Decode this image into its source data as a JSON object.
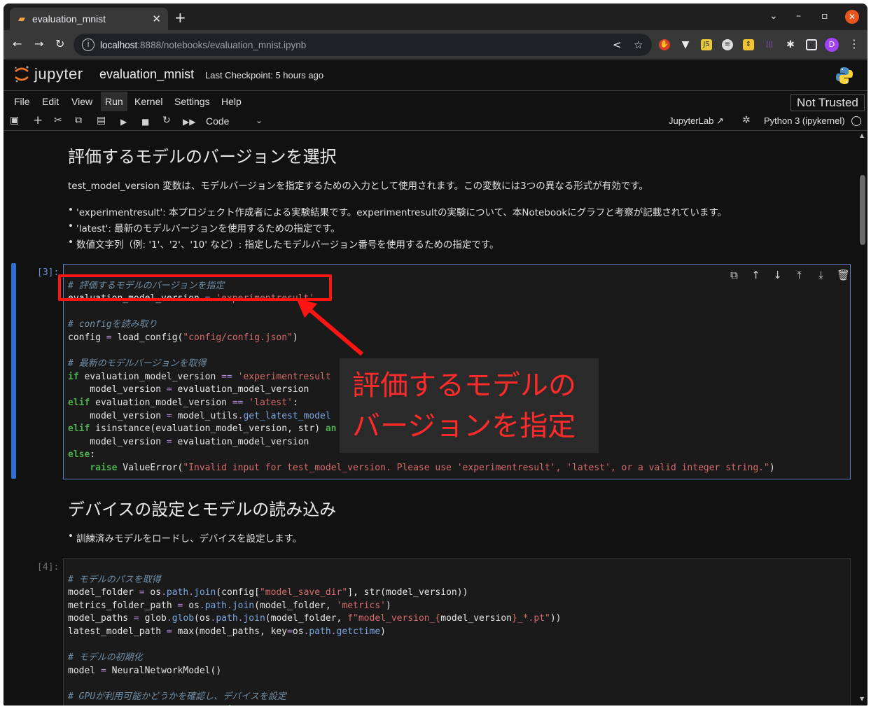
{
  "browser": {
    "tab_title": "evaluation_mnist",
    "url_host": "localhost",
    "url_path": ":8888/notebooks/evaluation_mnist.ipynb",
    "profile_initial": "D"
  },
  "jupyter": {
    "logo_text": "jupyter",
    "notebook_name": "evaluation_mnist",
    "checkpoint": "Last Checkpoint: 5 hours ago",
    "menu": [
      "File",
      "Edit",
      "View",
      "Run",
      "Kernel",
      "Settings",
      "Help"
    ],
    "trust_status": "Not Trusted",
    "cell_type": "Code",
    "jupyterlab_link": "JupyterLab",
    "kernel": "Python 3 (ipykernel)"
  },
  "markdown1": {
    "heading": "評価するモデルのバージョンを選択",
    "intro": "test_model_version 変数は、モデルバージョンを指定するための入力として使用されます。この変数には3つの異なる形式が有効です。",
    "bullets": [
      "'experimentresult': 本プロジェクト作成者による実験結果です。experimentresultの実験について、本Notebookにグラフと考察が記載されています。",
      "'latest': 最新のモデルバージョンを使用するための指定です。",
      "数値文字列（例: '1'、'2'、'10' など）: 指定したモデルバージョン番号を使用するための指定です。"
    ]
  },
  "cell3": {
    "prompt": "[3]:",
    "lines": [
      "# 評価するモデルのバージョンを指定",
      "evaluation_model_version = 'experimentresult'",
      "",
      "# configを読み取り",
      "config = load_config(\"config/config.json\")",
      "",
      "# 最新のモデルバージョンを取得",
      "if evaluation_model_version == 'experimentresult",
      "    model_version = evaluation_model_version",
      "elif evaluation_model_version == 'latest':",
      "    model_version = model_utils.get_latest_model",
      "elif isinstance(evaluation_model_version, str) an",
      "    model_version = evaluation_model_version",
      "else:",
      "    raise ValueError(\"Invalid input for test_model_version. Please use 'experimentresult', 'latest', or a valid integer string.\")"
    ]
  },
  "markdown2": {
    "heading": "デバイスの設定とモデルの読み込み",
    "bullets": [
      "訓練済みモデルをロードし、デバイスを設定します。"
    ]
  },
  "cell4": {
    "prompt": "[4]:",
    "lines": [
      "# モデルのパスを取得",
      "model_folder = os.path.join(config[\"model_save_dir\"], str(model_version))",
      "metrics_folder_path = os.path.join(model_folder, 'metrics')",
      "model_paths = glob.glob(os.path.join(model_folder, f\"model_version_{model_version}_*.pt\"))",
      "latest_model_path = max(model_paths, key=os.path.getctime)",
      "",
      "# モデルの初期化",
      "model = NeuralNetworkModel()",
      "",
      "# GPUが利用可能かどうかを確認し、デバイスを設定",
      "device = torch.device('cuda' if torch.cuda.is_available() else 'cpu')"
    ]
  },
  "annotation": {
    "line1": "評価するモデルの",
    "line2": "バージョンを指定"
  },
  "colors": {
    "accent": "#2f6fcf",
    "highlight": "#ff1414",
    "background": "#111111"
  }
}
